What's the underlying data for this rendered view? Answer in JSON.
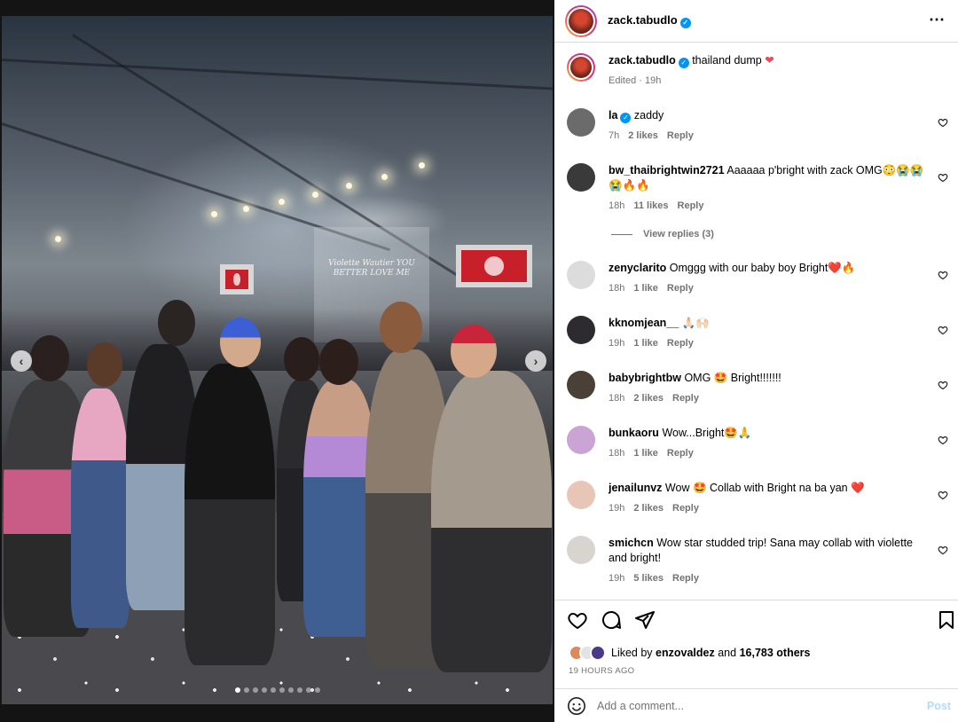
{
  "post": {
    "author": "zack.tabudlo",
    "caption_author": "zack.tabudlo",
    "caption": "thailand dump",
    "caption_emoji": "❤",
    "edited_label": "Edited · 19h",
    "more_glyph": "⋯"
  },
  "media": {
    "backdrop_text": "Violette Wautier YOU BETTER LOVE ME",
    "prev_glyph": "‹",
    "next_glyph": "›",
    "carousel_total": 10,
    "carousel_index": 1
  },
  "comments": [
    {
      "user": "la",
      "verified": true,
      "text": "zaddy",
      "time": "7h",
      "likes": "2 likes",
      "reply": "Reply",
      "avatar_color": "#6b6b6b"
    },
    {
      "user": "bw_thaibrightwin2721",
      "verified": false,
      "text": "Aaaaaa p'bright with zack OMG😳😭😭😭🔥🔥",
      "time": "18h",
      "likes": "11 likes",
      "reply": "Reply",
      "avatar_color": "#3a3a3a"
    },
    {
      "user": "zenyclarito",
      "verified": false,
      "text": "Omggg with our baby boy Bright❤️🔥",
      "time": "18h",
      "likes": "1 like",
      "reply": "Reply",
      "avatar_color": "#dcdcdc"
    },
    {
      "user": "kknomjean__",
      "verified": false,
      "text": "🙏🏻🙌🏻",
      "time": "19h",
      "likes": "1 like",
      "reply": "Reply",
      "avatar_color": "#2d2a30"
    },
    {
      "user": "babybrightbw",
      "verified": false,
      "text": "OMG 🤩 Bright!!!!!!!",
      "time": "18h",
      "likes": "2 likes",
      "reply": "Reply",
      "avatar_color": "#4a4038"
    },
    {
      "user": "bunkaoru",
      "verified": false,
      "text": "Wow...Bright🤩🙏",
      "time": "18h",
      "likes": "1 like",
      "reply": "Reply",
      "avatar_color": "#c9a4d4"
    },
    {
      "user": "jenailunvz",
      "verified": false,
      "text": "Wow 🤩 Collab with Bright na ba yan ❤️",
      "time": "19h",
      "likes": "2 likes",
      "reply": "Reply",
      "avatar_color": "#e7c6b8"
    },
    {
      "user": "smichcn",
      "verified": false,
      "text": "Wow star studded trip! Sana may collab with violette and bright!",
      "time": "19h",
      "likes": "5 likes",
      "reply": "Reply",
      "avatar_color": "#d8d4cf"
    }
  ],
  "view_replies": "View replies (3)",
  "likes_section": {
    "prefix": "Liked by",
    "user": "enzovaldez",
    "middle": "and",
    "count": "16,783 others",
    "time_ago": "19 HOURS AGO"
  },
  "add_comment": {
    "placeholder": "Add a comment...",
    "post_label": "Post"
  },
  "colors": {
    "verified": "#0095f6",
    "heart": "#ed4956",
    "post_disabled": "#b3dbff"
  }
}
